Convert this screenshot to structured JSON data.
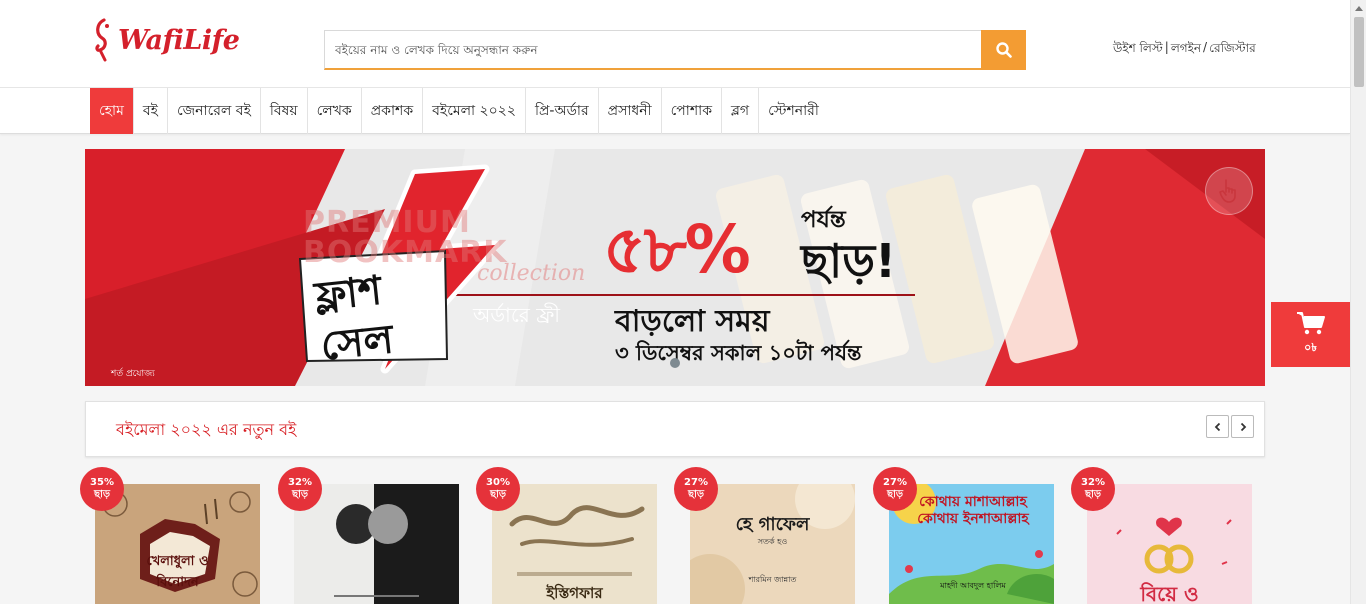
{
  "header": {
    "logo_text": "WafiLife",
    "search_placeholder": "বইয়ের নাম ও লেখক দিয়ে অনুসন্ধান করুন",
    "account": {
      "wishlist": "উইশ লিস্ট",
      "sep1": "|",
      "login": "লগইন",
      "sep2": "/",
      "register": "রেজিস্টার"
    }
  },
  "nav": {
    "items": [
      {
        "label": "হোম"
      },
      {
        "label": "বই"
      },
      {
        "label": "জেনারেল বই"
      },
      {
        "label": "বিষয়"
      },
      {
        "label": "লেখক"
      },
      {
        "label": "প্রকাশক"
      },
      {
        "label": "বইমেলা ২০২২"
      },
      {
        "label": "প্রি-অর্ডার"
      },
      {
        "label": "প্রসাধনী"
      },
      {
        "label": "পোশাক"
      },
      {
        "label": "ব্লগ"
      },
      {
        "label": "স্টেশনারী"
      }
    ]
  },
  "banner": {
    "premium": "PREMIUM",
    "bookmark": "BOOKMARK",
    "collection": "collection",
    "percent": "৫৮%",
    "upto": "পর্যন্ত",
    "off": "ছাড়!",
    "flash_line1": "ফ্লাশ",
    "flash_line2": "সেল",
    "free_text": "অর্ডারে ফ্রী",
    "extended": "বাড়লো সময়",
    "deadline": "৩ ডিসেম্বর সকাল ১০টা পর্যন্ত",
    "terms": "শর্ত প্রযোজ্য"
  },
  "cart": {
    "count": "০৳"
  },
  "section": {
    "title": "বইমেলা ২০২২ এর নতুন বই"
  },
  "books": [
    {
      "discount": "35%",
      "off": "ছাড়",
      "cover_title": "খেলাধুলা ও বিনোদন",
      "bg": "#c9a47c"
    },
    {
      "discount": "32%",
      "off": "ছাড়",
      "cover_title": "",
      "bg": "#1a1a1a"
    },
    {
      "discount": "30%",
      "off": "ছাড়",
      "cover_title": "ইস্তিগফার",
      "bg": "#ece2cc"
    },
    {
      "discount": "27%",
      "off": "ছাড়",
      "cover_title": "হে গাফেল",
      "cover_sub": "সতর্ক হও",
      "cover_author": "শারমিন জান্নাত",
      "bg": "#ecd8bc"
    },
    {
      "discount": "27%",
      "off": "ছাড়",
      "cover_title": "কোথায় মাশাআল্লাহ কোথায় ইনশাআল্লাহ",
      "cover_author": "মাহদী আবদুল হালিম",
      "bg": "#6ec4ea"
    },
    {
      "discount": "32%",
      "off": "ছাড়",
      "cover_title": "বিয়ে ও",
      "bg": "#f7d4dc"
    }
  ],
  "colors": {
    "brand_red": "#ef3b3b",
    "search_orange": "#f39c33",
    "title_red": "#d71d22"
  }
}
